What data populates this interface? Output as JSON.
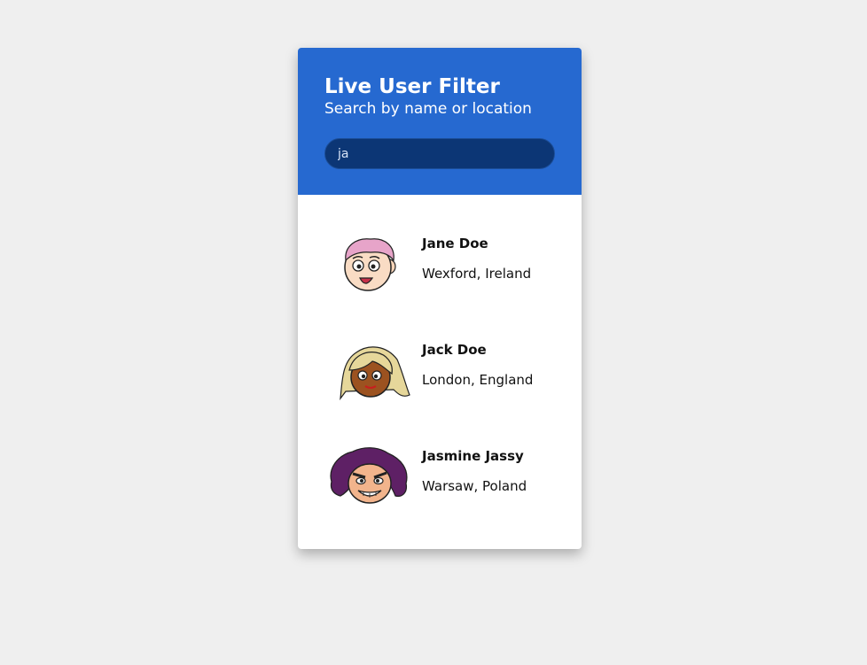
{
  "header": {
    "title": "Live User Filter",
    "subtitle": "Search by name or location"
  },
  "search": {
    "value": "ja",
    "placeholder": ""
  },
  "users": [
    {
      "name": "Jane Doe",
      "location": "Wexford, Ireland",
      "avatar_icon": "pink-hair-avatar-icon"
    },
    {
      "name": "Jack Doe",
      "location": "London, England",
      "avatar_icon": "blonde-hair-avatar-icon"
    },
    {
      "name": "Jasmine Jassy",
      "location": "Warsaw, Poland",
      "avatar_icon": "purple-hair-avatar-icon"
    }
  ],
  "colors": {
    "header_bg": "#2669d0",
    "search_bg": "#0c3675",
    "page_bg": "#efefef"
  }
}
